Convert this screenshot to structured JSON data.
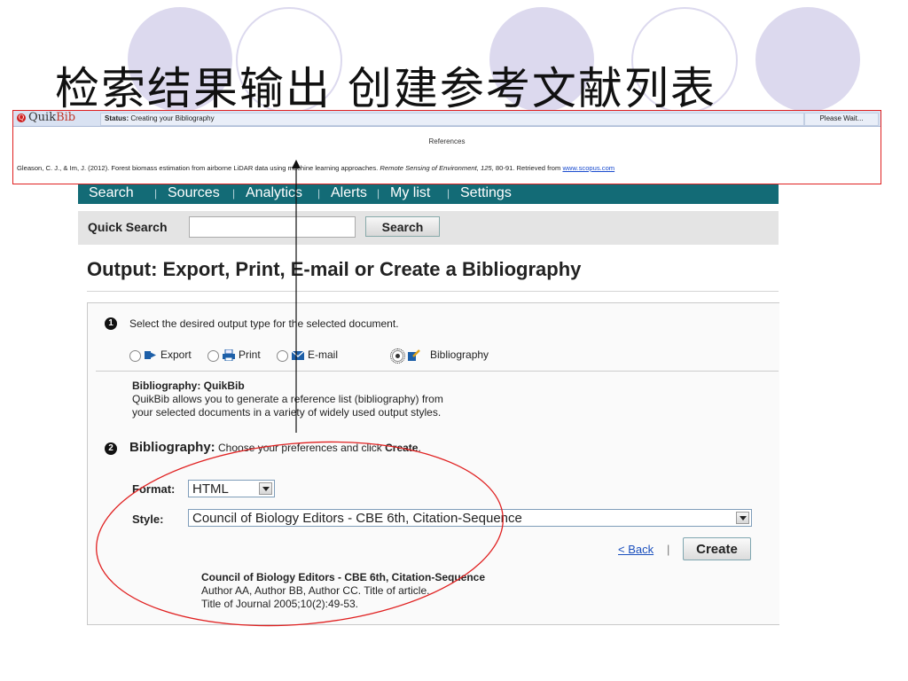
{
  "slide": {
    "title": "检索结果输出  创建参考文献列表"
  },
  "quikbib": {
    "logo_quik": "Quik",
    "logo_bib": "Bib",
    "logo_mark": "Q",
    "status_label": "Status:",
    "status_text": "Creating your Bibliography",
    "wait_text": "Please Wait...",
    "references_heading": "References",
    "reference": {
      "authors_year": "Gleason, C. J., & Im, J. (2012). Forest biomass estimation from airborne LiDAR data using machine learning approaches.",
      "journal": "Remote Sensing of Environment, 125,",
      "pages": "80-91. Retrieved from",
      "link": "www.scopus.com"
    }
  },
  "nav": {
    "items": [
      "Search",
      "Sources",
      "Analytics",
      "Alerts",
      "My list",
      "Settings"
    ],
    "separator": "|"
  },
  "quick_search": {
    "label": "Quick Search",
    "input_value": "",
    "button": "Search"
  },
  "page": {
    "title": "Output: Export, Print, E-mail or Create a Bibliography"
  },
  "step1": {
    "number": "1",
    "text": "Select the desired output type for the selected document.",
    "options": [
      {
        "label": "Export",
        "icon": "export-icon",
        "selected": false
      },
      {
        "label": "Print",
        "icon": "printer-icon",
        "selected": false
      },
      {
        "label": "E-mail",
        "icon": "envelope-icon",
        "selected": false
      },
      {
        "label": "Bibliography",
        "icon": "bibliography-icon",
        "selected": true
      }
    ]
  },
  "bibliography_info": {
    "title": "Bibliography: QuikBib",
    "line1": "QuikBib allows you to generate a reference list (bibliography) from",
    "line2": "your selected documents in a variety of widely used output styles."
  },
  "step2": {
    "number": "2",
    "heading": "Bibliography:",
    "text_before": "Choose your preferences and click",
    "text_bold": "Create",
    "text_after": "."
  },
  "form": {
    "format_label": "Format:",
    "format_value": "HTML",
    "style_label": "Style:",
    "style_value": "Council of Biology Editors - CBE 6th, Citation-Sequence"
  },
  "actions": {
    "back": "< Back",
    "separator": "|",
    "create": "Create"
  },
  "preview": {
    "title": "Council of Biology Editors - CBE 6th, Citation-Sequence",
    "line1": "Author AA, Author BB, Author CC. Title of article.",
    "line2": "Title of Journal 2005;10(2):49-53."
  },
  "colors": {
    "nav_bg": "#136b76",
    "annotation_red": "#e02020",
    "circle": "#dcd9ee",
    "link": "#1a4fbd"
  }
}
